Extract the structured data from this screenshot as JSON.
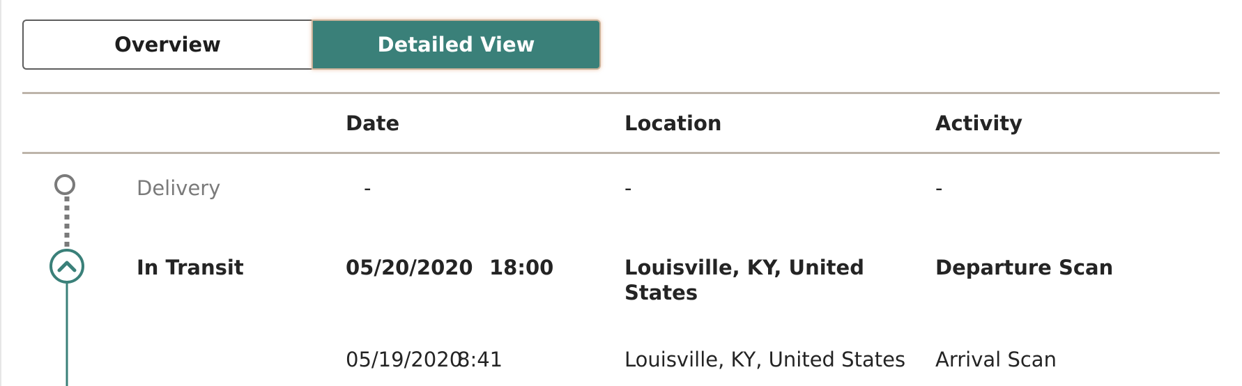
{
  "toggle": {
    "overview_label": "Overview",
    "detailed_label": "Detailed View",
    "active": "Detailed View"
  },
  "table": {
    "headers": {
      "date": "Date",
      "location": "Location",
      "activity": "Activity"
    },
    "rows": [
      {
        "status": "Delivery",
        "date": "-",
        "time": "",
        "location": "-",
        "activity": "-"
      },
      {
        "status": "In Transit",
        "date": "05/20/2020",
        "time": "18:00",
        "location": "Louisville, KY, United States",
        "activity": "Departure Scan"
      },
      {
        "status": "",
        "date": "05/19/2020",
        "time": "8:41",
        "location": "Louisville, KY, United States",
        "activity": "Arrival Scan"
      }
    ]
  },
  "icons": {
    "pending": "circle-outline-icon",
    "current": "chevron-up-icon"
  },
  "colors": {
    "accent": "#3a8079",
    "rule": "#bdb4aa",
    "muted": "#7a7a7a",
    "text": "#242424"
  }
}
